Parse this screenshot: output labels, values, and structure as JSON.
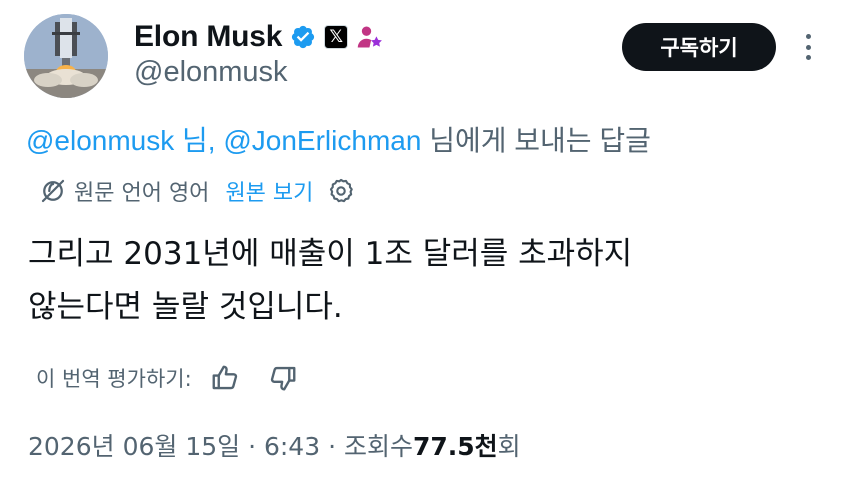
{
  "author": {
    "display_name": "Elon Musk",
    "handle": "@elonmusk",
    "verified_icon": "verified-badge-icon",
    "verified_color": "#1d9bf0",
    "org_badge_label": "𝕏",
    "affiliate_icon": "affiliate-user-icon",
    "affiliate_color": "#c13584"
  },
  "header": {
    "subscribe_label": "구독하기",
    "more_icon": "more-vertical-icon"
  },
  "reply_context": {
    "mention_1": "@elonmusk 님,",
    "mention_2": "@JonErlichman",
    "suffix": " 님에게 보내는 답글"
  },
  "translation": {
    "icon": "translate-globe-icon",
    "label": "원문 언어 영어",
    "show_original": "원본 보기",
    "settings_icon": "gear-icon"
  },
  "tweet": {
    "line_1": "그리고 2031년에 매출이 1조 달러를 초과하지",
    "line_2": "않는다면 놀랄 것입니다."
  },
  "rate_translation": {
    "label": "이 번역 평가하기:",
    "thumbs_up_icon": "thumbs-up-icon",
    "thumbs_down_icon": "thumbs-down-icon"
  },
  "meta": {
    "date_time": "2026년 06월 15일 · 6:43 · 조회수 ",
    "views_count": "77.5천",
    "views_suffix": "회"
  },
  "colors": {
    "text_primary": "#0f1419",
    "text_secondary": "#536471",
    "link": "#1d9bf0",
    "button_bg": "#0f1419"
  }
}
